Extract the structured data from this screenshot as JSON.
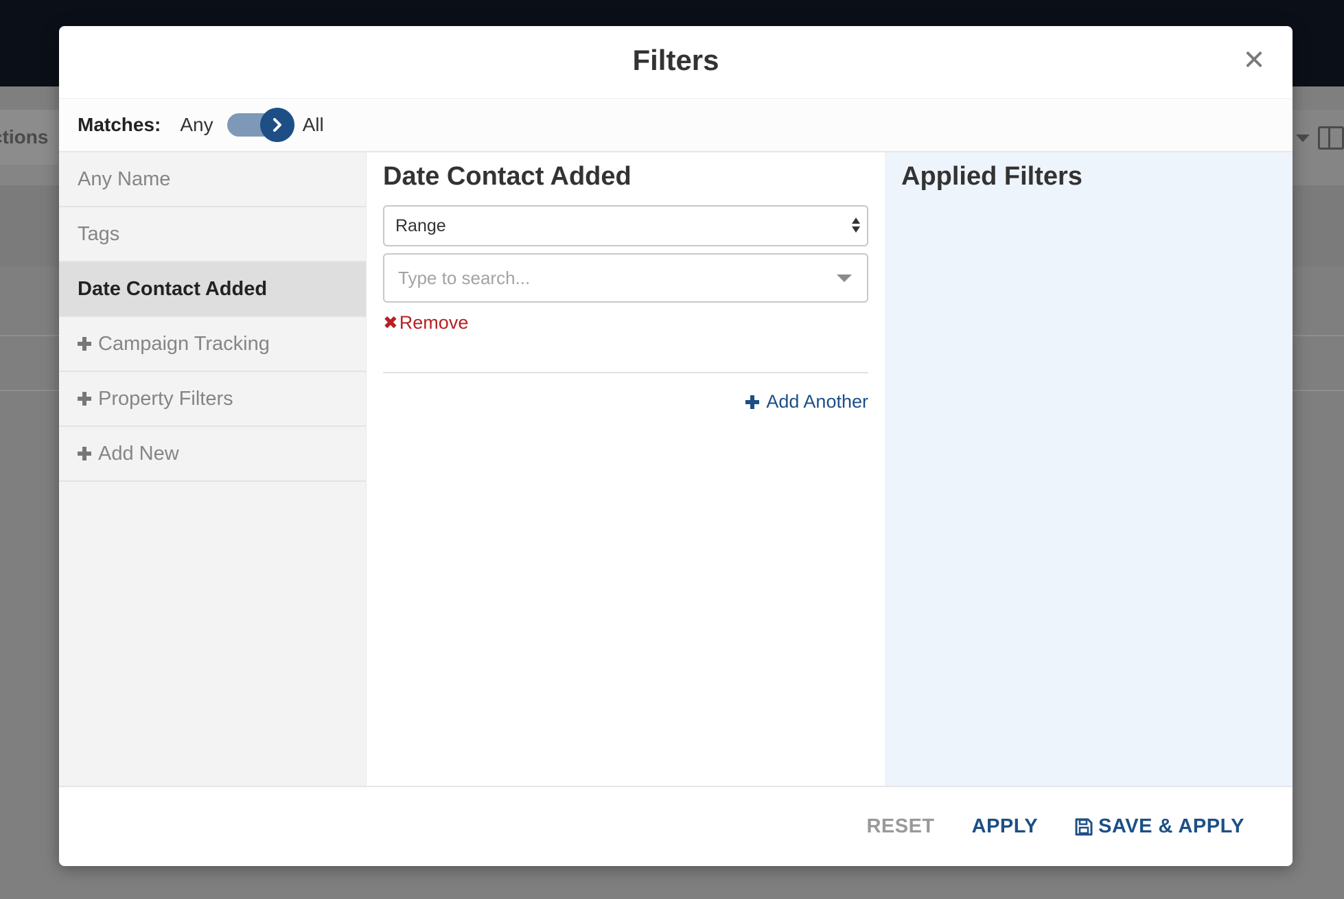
{
  "background": {
    "actions_label": "ctions"
  },
  "modal": {
    "title": "Filters",
    "matches": {
      "label": "Matches:",
      "option_any": "Any",
      "option_all": "All",
      "selected": "All"
    },
    "sidebar": {
      "items": [
        {
          "label": "Any Name",
          "expandable": false,
          "active": false
        },
        {
          "label": "Tags",
          "expandable": false,
          "active": false
        },
        {
          "label": "Date Contact Added",
          "expandable": false,
          "active": true
        },
        {
          "label": "Campaign Tracking",
          "expandable": true,
          "active": false
        },
        {
          "label": "Property Filters",
          "expandable": true,
          "active": false
        },
        {
          "label": "Add New",
          "expandable": true,
          "active": false
        }
      ]
    },
    "editor": {
      "title": "Date Contact Added",
      "select_value": "Range",
      "search_placeholder": "Type to search...",
      "remove_label": "Remove",
      "add_another_label": "Add Another"
    },
    "applied": {
      "title": "Applied Filters"
    },
    "footer": {
      "reset_label": "RESET",
      "apply_label": "APPLY",
      "save_apply_label": "SAVE & APPLY"
    }
  },
  "colors": {
    "accent": "#1d4f86",
    "danger": "#b72025",
    "applied_bg": "#eef4fc"
  }
}
